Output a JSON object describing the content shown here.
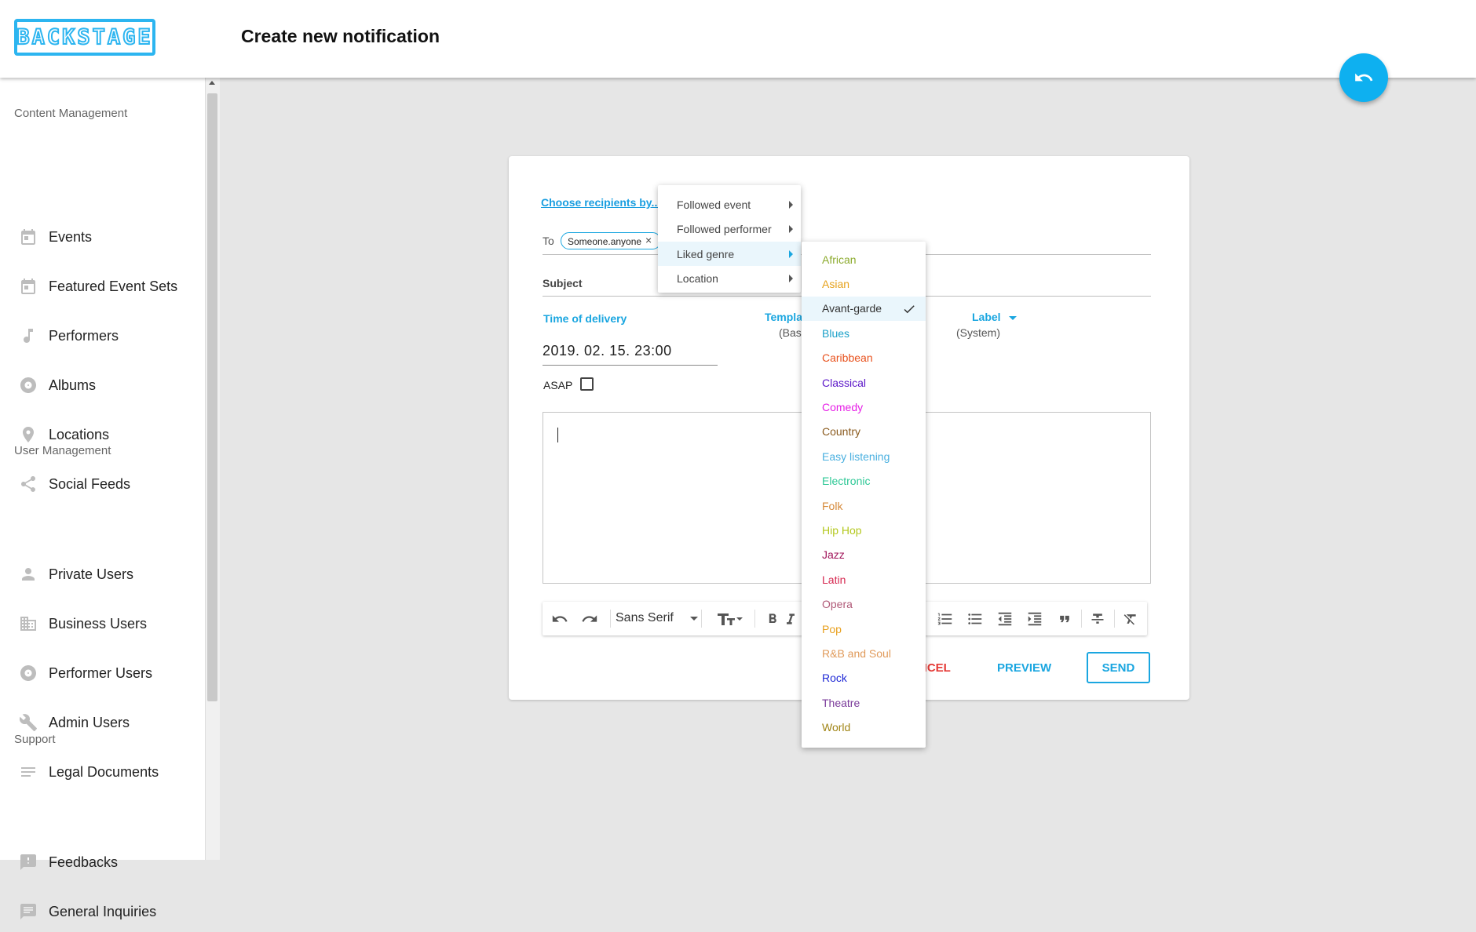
{
  "header": {
    "logo_text": "BACKSTAGE",
    "page_title": "Create new notification"
  },
  "sidebar": {
    "sections": [
      {
        "label": "Content Management"
      },
      {
        "label": "User Management"
      },
      {
        "label": "Support"
      }
    ],
    "items": [
      {
        "label": "Events",
        "icon": "calendar-icon"
      },
      {
        "label": "Featured Event Sets",
        "icon": "calendar-icon"
      },
      {
        "label": "Performers",
        "icon": "music-note-icon"
      },
      {
        "label": "Albums",
        "icon": "disc-icon"
      },
      {
        "label": "Locations",
        "icon": "location-pin-icon"
      },
      {
        "label": "Social Feeds",
        "icon": "share-icon"
      },
      {
        "label": "Private Users",
        "icon": "person-icon"
      },
      {
        "label": "Business Users",
        "icon": "building-icon"
      },
      {
        "label": "Performer Users",
        "icon": "disc-icon"
      },
      {
        "label": "Admin Users",
        "icon": "wrench-icon"
      },
      {
        "label": "Legal Documents",
        "icon": "list-icon"
      },
      {
        "label": "Feedbacks",
        "icon": "feedback-icon"
      },
      {
        "label": "General Inquiries",
        "icon": "chat-icon"
      }
    ]
  },
  "form": {
    "recipients_link": "Choose recipients by...",
    "to_label": "To",
    "recipient_chip": "Someone.anyone",
    "subject_label": "Subject",
    "time_label": "Time of delivery",
    "time_value": "2019. 02. 15. 23:00",
    "asap_label": "ASAP",
    "template_label": "Templa",
    "template_value": "(Bas",
    "label_label": "Label",
    "label_value": "(System)",
    "font_select": "Sans Serif",
    "cancel_label": "NCEL",
    "preview_label": "PREVIEW",
    "send_label": "SEND"
  },
  "recipient_menu": {
    "items": [
      {
        "label": "Followed event"
      },
      {
        "label": "Followed performer"
      },
      {
        "label": "Liked genre",
        "active": true
      },
      {
        "label": "Location"
      }
    ]
  },
  "genre_menu": {
    "items": [
      {
        "label": "African",
        "color": "#8cab2e"
      },
      {
        "label": "Asian",
        "color": "#e6a21c"
      },
      {
        "label": "Avant-garde",
        "color": "#333333",
        "selected": true
      },
      {
        "label": "Blues",
        "color": "#1aa0c8"
      },
      {
        "label": "Caribbean",
        "color": "#e8521e"
      },
      {
        "label": "Classical",
        "color": "#5a14c8"
      },
      {
        "label": "Comedy",
        "color": "#e61ee6"
      },
      {
        "label": "Country",
        "color": "#8a5a1e"
      },
      {
        "label": "Easy listening",
        "color": "#4ab0e0"
      },
      {
        "label": "Electronic",
        "color": "#2ec896"
      },
      {
        "label": "Folk",
        "color": "#d68a3a"
      },
      {
        "label": "Hip Hop",
        "color": "#b4c81e"
      },
      {
        "label": "Jazz",
        "color": "#a0145a"
      },
      {
        "label": "Latin",
        "color": "#d62850"
      },
      {
        "label": "Opera",
        "color": "#b05a78"
      },
      {
        "label": "Pop",
        "color": "#e8a01e"
      },
      {
        "label": "R&B and Soul",
        "color": "#e09a5a"
      },
      {
        "label": "Rock",
        "color": "#1e28d6"
      },
      {
        "label": "Theatre",
        "color": "#7a3a9a"
      },
      {
        "label": "World",
        "color": "#a08414"
      }
    ]
  }
}
